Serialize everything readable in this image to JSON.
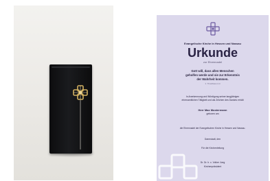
{
  "certificate": {
    "org": "Evangelische Kirche in Hessen und Nassau",
    "title": "Urkunde",
    "subtitle": "zur Ehrennadel",
    "verse": [
      "Gott will, dass allen Menschen",
      "geholfen werde und sie zur Erkenntnis",
      "der Wahrheit kommen."
    ],
    "verse_ref": "1. Timotheus 2,4",
    "recognition": [
      "In Anerkennung und Würdigung seiner langjährigen",
      "ehrenamtlichen Tätigkeit und als Zeichen des Dankes erhält"
    ],
    "recipient": "Herr Max Mustermann",
    "born": "geboren am",
    "award": "die Ehrennadel der Evangelischen Kirche in Hessen und Nassau.",
    "place": "Darmstadt, den",
    "leaders": "Für die Kirchenleitung",
    "signer": "Dr. Dr. h. c. Volker Jung",
    "role": "Kirchenpräsident"
  },
  "colors": {
    "paper": "#dcd8ec",
    "ink": "#2b2540",
    "box": "#111214",
    "pin_gold": "#d2b061"
  },
  "icons": {
    "pin": "ehrennadel-pin-icon",
    "logo": "ekhn-cross-logo-icon",
    "watermark": "cross-watermark-icon"
  }
}
